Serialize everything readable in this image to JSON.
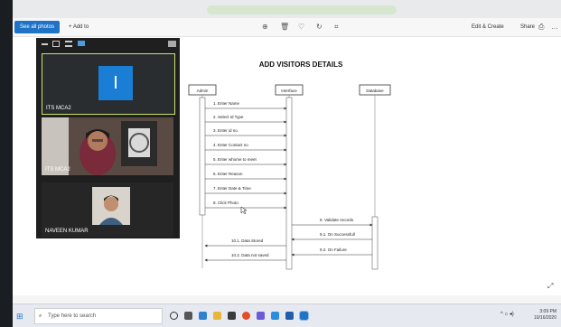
{
  "toolbar": {
    "see_all_label": "See all photos",
    "add_to_label": "+ Add to",
    "edit_create_label": "Edit & Create",
    "share_label": "Share",
    "icons": [
      "zoom-in-icon",
      "delete-icon",
      "favorite-icon",
      "rotate-icon",
      "crop-icon",
      "print-icon",
      "more-icon"
    ]
  },
  "call_panel": {
    "tiles": [
      {
        "name": "ITS MCA2",
        "initial": "I"
      },
      {
        "name": "ITS MCA2"
      },
      {
        "name": "NAVEEN KUMAR"
      }
    ]
  },
  "diagram": {
    "title": "ADD VISITORS DETAILS",
    "lifelines": [
      "Admin",
      "Interface",
      "Database"
    ],
    "messages": [
      "1. Enter Name",
      "2. Select Id Type",
      "3. Enter id no.",
      "4. Enter Contact no",
      "5. Enter whome to meet",
      "6. Enter Reason",
      "7. Enter Date & Time",
      "8. Click Photo",
      "9. Validate records",
      "9.1. On Successfull",
      "9.2. On Failure",
      "10.1. Data Stored",
      "10.2. Data not saved"
    ]
  },
  "taskbar": {
    "search_placeholder": "Type here to search",
    "time": "3:09 PM",
    "date": "10/16/2020"
  },
  "colors": {
    "accent": "#1e73c8",
    "active_speaker_border": "#c9e36a"
  }
}
